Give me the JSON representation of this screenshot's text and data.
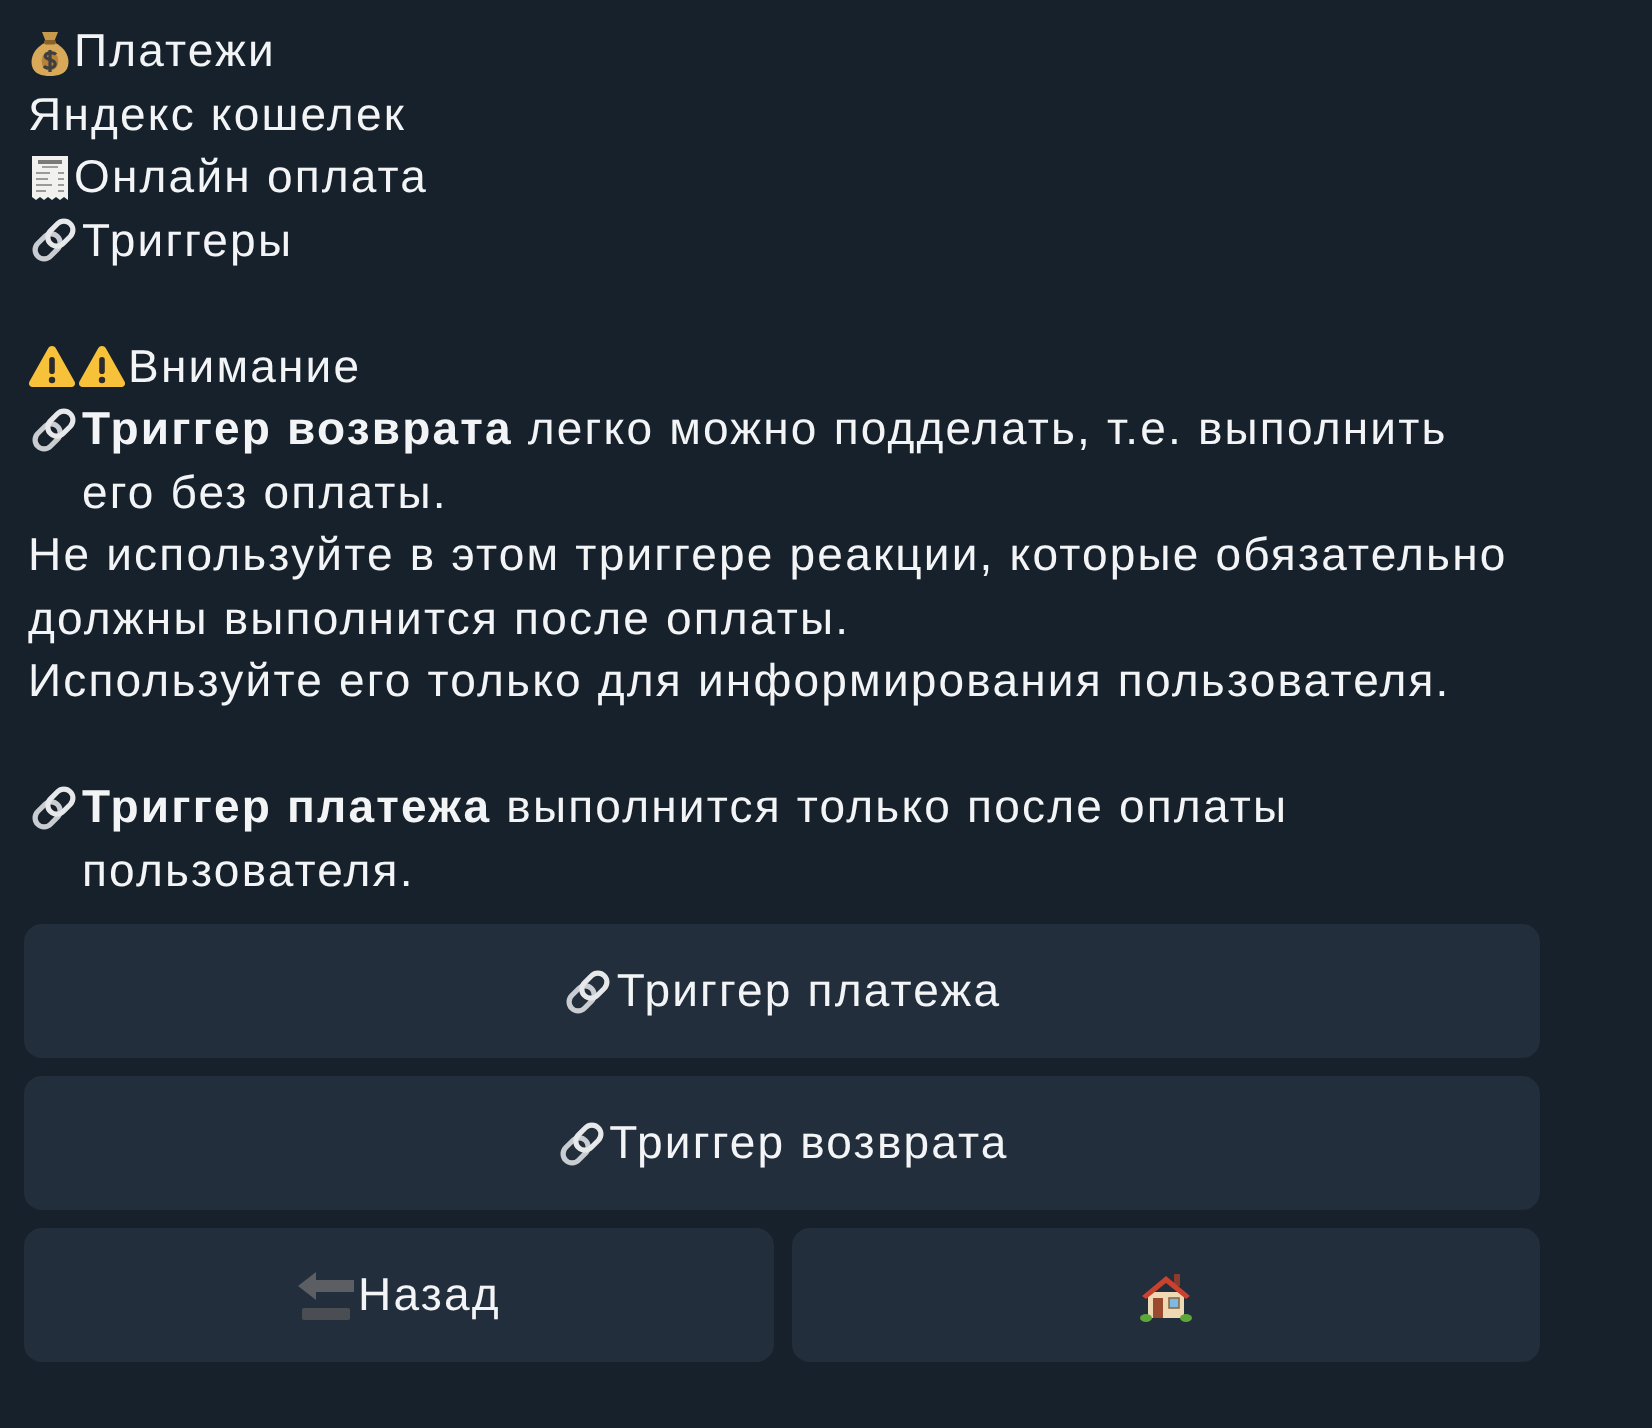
{
  "message": {
    "sections": [
      {
        "lines": [
          {
            "kind": "money",
            "text": "Платежи"
          },
          {
            "kind": "plain",
            "text": "Яндекс кошелек"
          },
          {
            "kind": "receipt",
            "text": "Онлайн оплата"
          },
          {
            "kind": "link",
            "text": "Триггеры"
          }
        ]
      },
      {
        "lines": [
          {
            "kind": "alert",
            "text": "Внимание"
          },
          {
            "kind": "link",
            "text": "**Триггер возврата** легко можно подделать, т.е. выполнить его без оплаты."
          },
          {
            "kind": "plain",
            "text": "Не используйте в этом триггере реакции, которые обязательно должны выполнится после оплаты."
          },
          {
            "kind": "plain",
            "text": "Используйте его только для информирования пользователя."
          }
        ]
      },
      {
        "lines": [
          {
            "kind": "link",
            "text": "**Триггер платежа** выполнится только после оплаты пользователя."
          }
        ]
      }
    ]
  },
  "keyboard": {
    "rows": [
      {
        "buttons": [
          {
            "kind": "link",
            "label": "Триггер платежа"
          }
        ]
      },
      {
        "buttons": [
          {
            "kind": "link",
            "label": "Триггер возврата"
          }
        ]
      },
      {
        "buttons": [
          {
            "kind": "back",
            "label": "Назад"
          },
          {
            "kind": "home"
          }
        ]
      }
    ]
  }
}
